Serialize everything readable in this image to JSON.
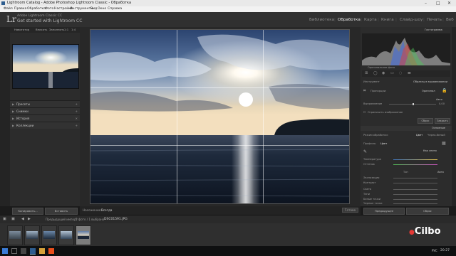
{
  "window": {
    "title": "Lightroom Catalog - Adobe Photoshop Lightroom Classic - Обработка",
    "minimize": "–",
    "maximize": "□",
    "close": "✕"
  },
  "menu": [
    "Файл",
    "Правка",
    "Обработка",
    "Фото",
    "Настройки",
    "Инструменты",
    "Вид",
    "Окно",
    "Справка"
  ],
  "identity": {
    "logo": "Lr",
    "catalog_line": "Adobe Lightroom Classic CC",
    "get_started": "Get started with Lightroom CC"
  },
  "modules": [
    {
      "label": "Библиотека",
      "active": false
    },
    {
      "label": "Обработка",
      "active": true
    },
    {
      "label": "Карта",
      "active": false
    },
    {
      "label": "Книга",
      "active": false
    },
    {
      "label": "Слайд-шоу",
      "active": false
    },
    {
      "label": "Печать",
      "active": false
    },
    {
      "label": "Веб",
      "active": false
    }
  ],
  "left_panel": {
    "navigator_label": "Навигатор",
    "fit_label": "Вписать",
    "fill_label": "Заполнить",
    "zoom_1": "1:1",
    "zoom_2": "1:4",
    "sections": [
      {
        "label": "Пресеты"
      },
      {
        "label": "Снимки"
      },
      {
        "label": "История"
      },
      {
        "label": "Коллекции"
      }
    ],
    "copy_button": "Копировать...",
    "paste_button": "Вставить"
  },
  "toolbar": {
    "overlay_label": "Наложение:",
    "overlay_value": "Всегда",
    "done_button": "Готово"
  },
  "filmstrip_bar": {
    "source_label": "Предыдущий импорт",
    "count_label": "5 фото / 1 выбрано",
    "file_name": "DSC01591.JPG"
  },
  "right_panel": {
    "histogram_label": "Гистограмма",
    "original_photo": "Оригинальное фото",
    "crop_section": "Инструмент",
    "crop_aspect_label": "Образец в выравнивании",
    "aspect_label": "Пропорции:",
    "aspect_value": "Оригинал",
    "angle_label": "Выпрямление",
    "angle_value": "0,00",
    "auto_label": "Авто",
    "constrain_label": "Ограничить изображение",
    "reset_button": "Сброс",
    "close_button": "Закрыть",
    "basic_header": "Основные",
    "treatment_label": "Режим обработки:",
    "color_label": "Цвет",
    "bw_label": "Черно-белый",
    "profile_label": "Профиль:",
    "profile_value": "Цвет",
    "wb_label": "Как снято",
    "temp_label": "Температура",
    "tint_label": "Оттенок",
    "tone_label": "Тон",
    "tone_auto": "Авто",
    "exposure_label": "Экспозиция",
    "contrast_label": "Контраст",
    "highlights_label": "Света",
    "shadows_label": "Тени",
    "whites_label": "Белые точки",
    "blacks_label": "Черные точки",
    "prev_button": "Предыдущее",
    "reset_all_button": "Сброс"
  },
  "watermark": "Cilbo",
  "taskbar": {
    "lang": "РУС",
    "time": "20:27"
  },
  "colors": {
    "panel_bg": "#2c2c2c",
    "active_module": "#f2f2f2",
    "inactive_module": "#8e8e8e"
  }
}
